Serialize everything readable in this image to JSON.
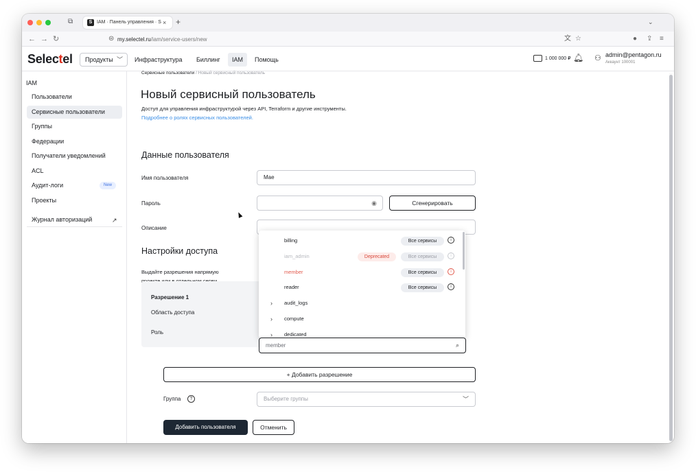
{
  "browser": {
    "tab_title": "IAM · Панель управления · Selectel",
    "tab_close": "×",
    "tab_new": "+",
    "url_host": "my.selectel.ru",
    "url_path": "/iam/service-users/new"
  },
  "colors": {
    "accent": "#e0301e",
    "primary_button": "#1d2733",
    "link": "#3a8ee6",
    "deprecated": "#d9473a"
  },
  "header": {
    "logo_part1": "Selec",
    "logo_part2": "t",
    "logo_part3": "el",
    "products_label": "Продукты",
    "nav": [
      "Инфраструктура",
      "Биллинг",
      "IAM",
      "Помощь"
    ],
    "balance": "1 000 000 ₽",
    "user_email": "admin@pentagon.ru",
    "user_account": "Аккаунт 100001"
  },
  "sidebar": {
    "heading": "IAM",
    "items": [
      {
        "label": "Пользователи"
      },
      {
        "label": "Сервисные пользователи"
      },
      {
        "label": "Группы"
      },
      {
        "label": "Федерации"
      },
      {
        "label": "Получатели уведомлений"
      },
      {
        "label": "ACL"
      },
      {
        "label": "Аудит-логи",
        "badge": "New"
      },
      {
        "label": "Проекты"
      },
      {
        "label": "Журнал авторизаций"
      }
    ]
  },
  "main": {
    "breadcrumb_parent": "Сервисные пользователи",
    "breadcrumb_sep": "/",
    "breadcrumb_current": "Новый сервисный пользователь",
    "title": "Новый сервисный пользователь",
    "description": "Доступ для управления инфраструктурой через API, Terraform и другие инструменты.",
    "roles_link": "Подробнее о ролях сервисных пользователей.",
    "section_user_data": "Данные пользователя",
    "username_label": "Имя пользователя",
    "username_value": "Mae",
    "password_label": "Пароль",
    "password_value": "",
    "generate_button": "Сгенерировать",
    "description_label": "Описание",
    "section_access": "Настройки доступа",
    "access_text_1": "Выдайте разрешения напрямую",
    "access_text_2": "проекте или в отдельном серви",
    "permission_title": "Разрешение 1",
    "scope_label": "Область доступа",
    "role_label": "Роль",
    "role_search_value": "member",
    "add_permission": "+ Добавить разрешение",
    "group_label": "Группа",
    "group_placeholder": "Выберите группы",
    "submit_button": "Добавить пользователя",
    "cancel_button": "Отменить"
  },
  "role_dropdown": {
    "roles": [
      {
        "name": "billing",
        "tag": "Все сервисы",
        "state": "normal"
      },
      {
        "name": "iam_admin",
        "tag": "Все сервисы",
        "state": "disabled",
        "badge": "Deprecated"
      },
      {
        "name": "member",
        "tag": "Все сервисы",
        "state": "matched"
      },
      {
        "name": "reader",
        "tag": "Все сервисы",
        "state": "normal"
      }
    ],
    "groups": [
      "audit_logs",
      "compute",
      "dedicated"
    ]
  }
}
